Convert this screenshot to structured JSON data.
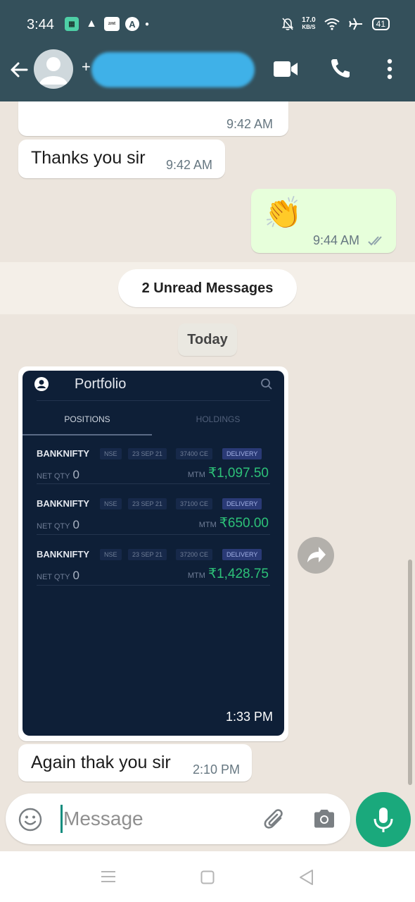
{
  "status_bar": {
    "time": "3:44",
    "app_icons": [
      "sheet-app-icon",
      "triangle-app-icon",
      "zomato-app-icon",
      "a-app-icon"
    ],
    "net_speed_value": "17.0",
    "net_speed_unit": "KB/S",
    "battery": "41"
  },
  "header": {
    "contact_prefix": "+",
    "contact_name_redacted": "",
    "icons": [
      "back-arrow-icon",
      "video-call-icon",
      "voice-call-icon",
      "more-options-icon"
    ]
  },
  "messages": [
    {
      "type": "incoming",
      "text": "",
      "time": "9:42 AM"
    },
    {
      "type": "incoming",
      "text": "Thanks you sir",
      "time": "9:42 AM"
    },
    {
      "type": "outgoing",
      "text": "👏",
      "time": "9:44 AM",
      "status": "read"
    },
    {
      "type": "incoming_image",
      "time": "1:33 PM"
    },
    {
      "type": "incoming",
      "text": "Again thak you sir",
      "time": "2:10 PM"
    }
  ],
  "unread_banner": "2 Unread Messages",
  "date_divider": "Today",
  "image_content": {
    "title": "Portfolio",
    "tabs": [
      "POSITIONS",
      "HOLDINGS"
    ],
    "active_tab": "POSITIONS",
    "net_qty_label": "NET QTY",
    "mtm_label": "MTM",
    "positions": [
      {
        "symbol": "BANKNIFTY",
        "exchange": "NSE",
        "expiry": "23 SEP 21",
        "strike": "37400 CE",
        "product": "DELIVERY",
        "net_qty": "0",
        "mtm": "₹1,097.50"
      },
      {
        "symbol": "BANKNIFTY",
        "exchange": "NSE",
        "expiry": "23 SEP 21",
        "strike": "37100 CE",
        "product": "DELIVERY",
        "net_qty": "0",
        "mtm": "₹650.00"
      },
      {
        "symbol": "BANKNIFTY",
        "exchange": "NSE",
        "expiry": "23 SEP 21",
        "strike": "37200 CE",
        "product": "DELIVERY",
        "net_qty": "0",
        "mtm": "₹1,428.75"
      }
    ]
  },
  "composer": {
    "placeholder": "Message",
    "icons": [
      "emoji-icon",
      "attach-icon",
      "camera-icon",
      "mic-icon"
    ]
  },
  "colors": {
    "header": "#34505b",
    "chat_background": "#ece5dd",
    "outgoing_bubble": "#e7ffdb",
    "accent": "#1aa97c",
    "positive_value": "#2dc178"
  }
}
